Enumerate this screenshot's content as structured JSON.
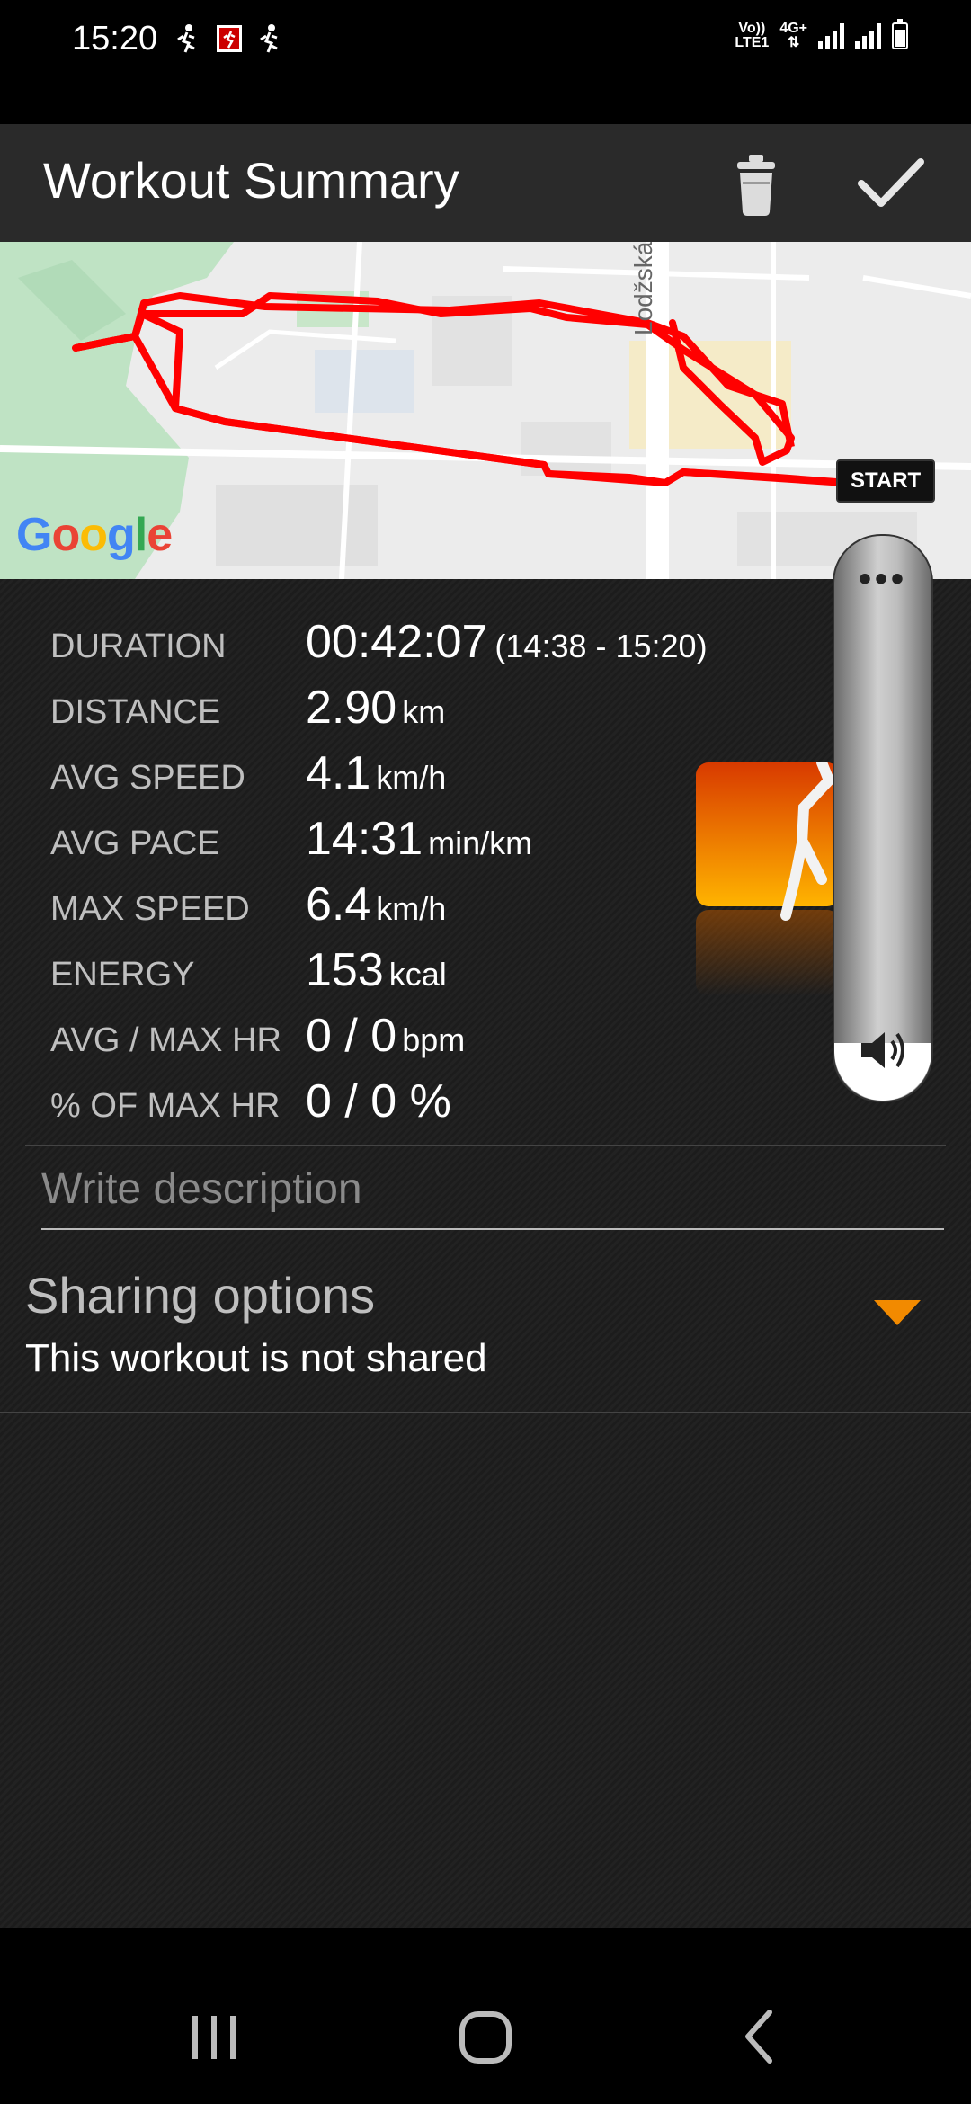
{
  "status_bar": {
    "time": "15:20",
    "network_label_top": "Vo))",
    "network_label_bottom": "LTE1",
    "network_gen": "4G+",
    "icons": [
      "walk-notification-icon",
      "runner-app-icon",
      "walk-notification-icon",
      "signal-icon",
      "signal-icon",
      "battery-icon"
    ]
  },
  "app_bar": {
    "title": "Workout Summary",
    "icons": [
      "trash-icon",
      "check-icon"
    ]
  },
  "map": {
    "provider_logo": "Google",
    "street_label": "Lodžská",
    "start_badge": "START",
    "route_color": "#ff0000"
  },
  "stats": [
    {
      "label": "DURATION",
      "value": "00:42:07",
      "unit": "",
      "extra": "(14:38 - 15:20)"
    },
    {
      "label": "DISTANCE",
      "value": "2.90",
      "unit": "km",
      "extra": ""
    },
    {
      "label": "AVG SPEED",
      "value": "4.1",
      "unit": "km/h",
      "extra": ""
    },
    {
      "label": "AVG PACE",
      "value": "14:31",
      "unit": "min/km",
      "extra": ""
    },
    {
      "label": "MAX SPEED",
      "value": "6.4",
      "unit": "km/h",
      "extra": ""
    },
    {
      "label": "ENERGY",
      "value": "153",
      "unit": "kcal",
      "extra": ""
    },
    {
      "label": "AVG / MAX HR",
      "value": "0 / 0",
      "unit": "bpm",
      "extra": ""
    },
    {
      "label": "% OF MAX HR",
      "value": "0 / 0 %",
      "unit": "",
      "extra": ""
    }
  ],
  "description": {
    "placeholder": "Write description"
  },
  "sharing": {
    "title": "Sharing options",
    "status": "This workout is not shared",
    "arrow_color": "#f28a00"
  },
  "side_panel": {
    "menu_glyph": "•••",
    "icons": [
      "more-icon",
      "volume-icon"
    ]
  },
  "nav_bar": {
    "icons": [
      "recent-apps-icon",
      "home-icon",
      "back-icon"
    ]
  },
  "colors": {
    "accent": "#f28a00",
    "background": "#1a1a1a",
    "appbar": "#2a2a2a"
  }
}
